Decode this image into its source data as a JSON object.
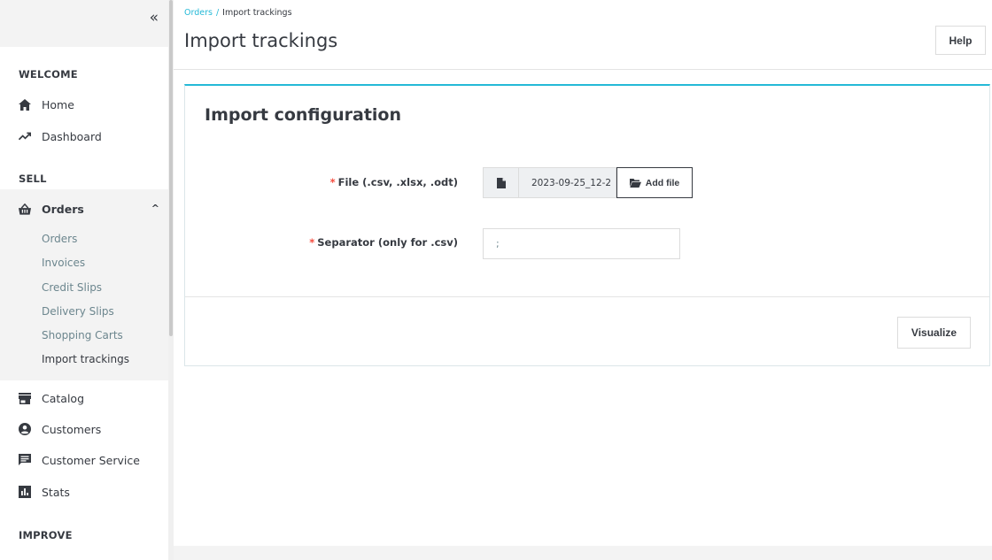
{
  "sidebar": {
    "collapse_glyph": "«",
    "sections": {
      "welcome": "WELCOME",
      "sell": "SELL",
      "improve": "IMPROVE"
    },
    "welcome_items": [
      {
        "label": "Home",
        "icon": "home-icon"
      },
      {
        "label": "Dashboard",
        "icon": "trending-up-icon"
      }
    ],
    "orders": {
      "label": "Orders",
      "icon": "shopping-basket-icon",
      "caret": "^",
      "children": [
        "Orders",
        "Invoices",
        "Credit Slips",
        "Delivery Slips",
        "Shopping Carts",
        "Import trackings"
      ],
      "active_child": "Import trackings"
    },
    "sell_items": [
      {
        "label": "Catalog",
        "icon": "store-icon"
      },
      {
        "label": "Customers",
        "icon": "account-circle-icon"
      },
      {
        "label": "Customer Service",
        "icon": "chat-icon"
      },
      {
        "label": "Stats",
        "icon": "bar-chart-icon"
      }
    ]
  },
  "header": {
    "breadcrumb": {
      "parent": "Orders",
      "separator": "/",
      "current": "Import trackings"
    },
    "title": "Import trackings",
    "help_label": "Help"
  },
  "card": {
    "title": "Import configuration",
    "file_field": {
      "required_mark": "*",
      "label": "File (.csv, .xlsx, .odt)",
      "file_name": "2023-09-25_12-2",
      "add_label": "Add file"
    },
    "separator_field": {
      "required_mark": "*",
      "label": "Separator (only for .csv)",
      "value": ";"
    },
    "visualize_label": "Visualize"
  },
  "colors": {
    "accent": "#25b9d7",
    "required": "#f54c3e",
    "text": "#363a41",
    "muted": "#6c868e"
  }
}
